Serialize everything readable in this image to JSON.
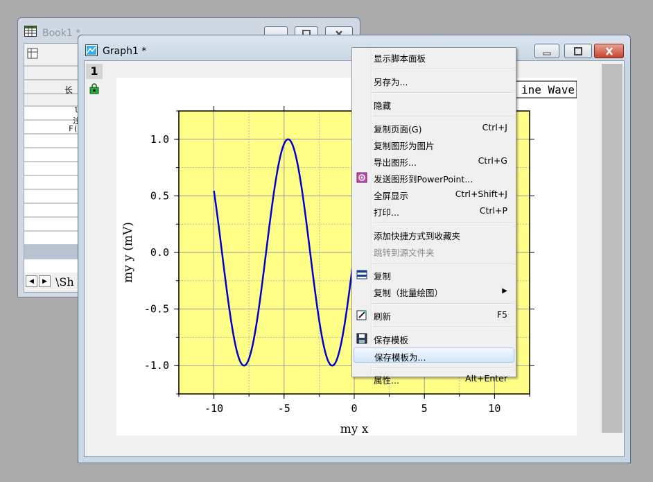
{
  "book": {
    "title": "Book1 *",
    "cells": [
      "长",
      "l",
      "注",
      "F("
    ],
    "sheet_tab": "Sh"
  },
  "graph": {
    "title": "Graph1 *",
    "layer_number": "1",
    "legend_text": "ine Wave"
  },
  "chart_data": {
    "type": "line",
    "title": "",
    "xlabel": "my x",
    "ylabel": "my y (mV)",
    "xlim": [
      -12.5,
      12.5
    ],
    "ylim": [
      -1.25,
      1.25
    ],
    "xticks": [
      -10,
      -5,
      0,
      5,
      10
    ],
    "xtick_labels": [
      "-10",
      "-5",
      "0",
      "5",
      "10"
    ],
    "yticks": [
      -1.0,
      -0.5,
      0.0,
      0.5,
      1.0
    ],
    "ytick_labels": [
      "-1.0",
      "-0.5",
      "0.0",
      "0.5",
      "1.0"
    ],
    "grid": true,
    "plot_background": "#ffff88",
    "series": [
      {
        "color": "#0000cc",
        "function": "sin(x)",
        "x_range": [
          -10,
          0
        ]
      }
    ]
  },
  "context_menu": {
    "items": [
      {
        "label": "显示脚本面板",
        "shortcut": ""
      },
      {
        "separator": true
      },
      {
        "label": "另存为...",
        "shortcut": ""
      },
      {
        "separator": true
      },
      {
        "label": "隐藏",
        "shortcut": ""
      },
      {
        "separator": true
      },
      {
        "label": "复制页面(G)",
        "shortcut": "Ctrl+J"
      },
      {
        "label": "复制图形为图片",
        "shortcut": ""
      },
      {
        "label": "导出图形...",
        "shortcut": "Ctrl+G"
      },
      {
        "label": "发送图形到PowerPoint...",
        "shortcut": "",
        "icon": "powerpoint-icon"
      },
      {
        "label": "全屏显示",
        "shortcut": "Ctrl+Shift+J"
      },
      {
        "label": "打印...",
        "shortcut": "Ctrl+P"
      },
      {
        "separator": true
      },
      {
        "label": "添加快捷方式到收藏夹",
        "shortcut": ""
      },
      {
        "label": "跳转到源文件夹",
        "shortcut": "",
        "disabled": true
      },
      {
        "separator": true
      },
      {
        "label": "复制",
        "shortcut": "",
        "icon": "duplicate-icon"
      },
      {
        "label": "复制（批量绘图）",
        "shortcut": "",
        "submenu": true
      },
      {
        "separator": true
      },
      {
        "label": "刷新",
        "shortcut": "F5",
        "icon": "refresh-icon"
      },
      {
        "separator": true
      },
      {
        "label": "保存模板",
        "shortcut": "",
        "icon": "save-icon"
      },
      {
        "label": "保存模板为...",
        "shortcut": "",
        "highlighted": true
      },
      {
        "separator": true
      },
      {
        "label": "属性...",
        "shortcut": "Alt+Enter"
      }
    ]
  }
}
